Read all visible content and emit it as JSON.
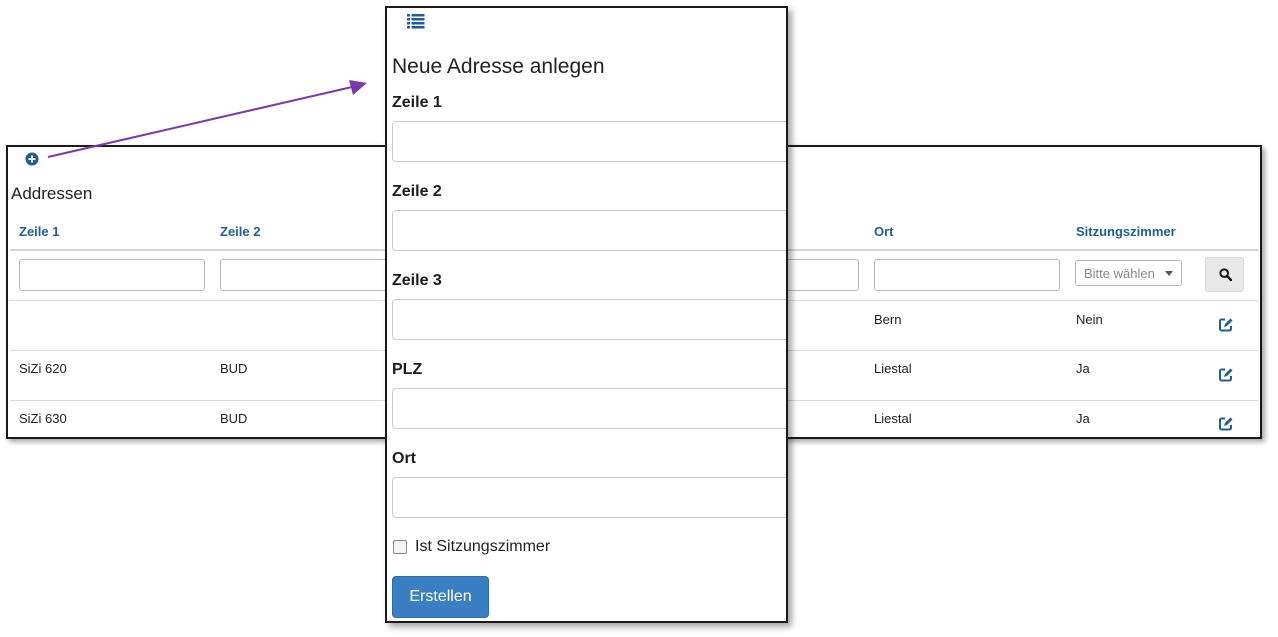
{
  "list": {
    "title": "Addressen",
    "columns": [
      "Zeile 1",
      "Zeile 2",
      "Ort",
      "Sitzungszimmer"
    ],
    "select_placeholder": "Bitte wählen",
    "rows": [
      {
        "zeile1": "",
        "zeile2": "",
        "ort": "Bern",
        "sitzungszimmer": "Nein"
      },
      {
        "zeile1": "SiZi 620",
        "zeile2": "BUD",
        "ort": "Liestal",
        "sitzungszimmer": "Ja"
      },
      {
        "zeile1": "SiZi 630",
        "zeile2": "BUD",
        "ort": "Liestal",
        "sitzungszimmer": "Ja"
      }
    ]
  },
  "modal": {
    "title": "Neue Adresse anlegen",
    "fields": [
      {
        "label": "Zeile 1",
        "value": ""
      },
      {
        "label": "Zeile 2",
        "value": ""
      },
      {
        "label": "Zeile 3",
        "value": ""
      },
      {
        "label": "PLZ",
        "value": ""
      },
      {
        "label": "Ort",
        "value": ""
      }
    ],
    "checkbox_label": "Ist Sitzungszimmer",
    "checkbox_checked": false,
    "submit_label": "Erstellen"
  },
  "colors": {
    "header_text": "#1f5c9c",
    "primary_button": "#3a7fc1",
    "arrow": "#7a3aa8",
    "icon_blue": "#1f5c9c"
  },
  "icons": [
    "plus-circle-icon",
    "list-icon",
    "search-icon",
    "edit-icon",
    "caret-down-icon"
  ]
}
